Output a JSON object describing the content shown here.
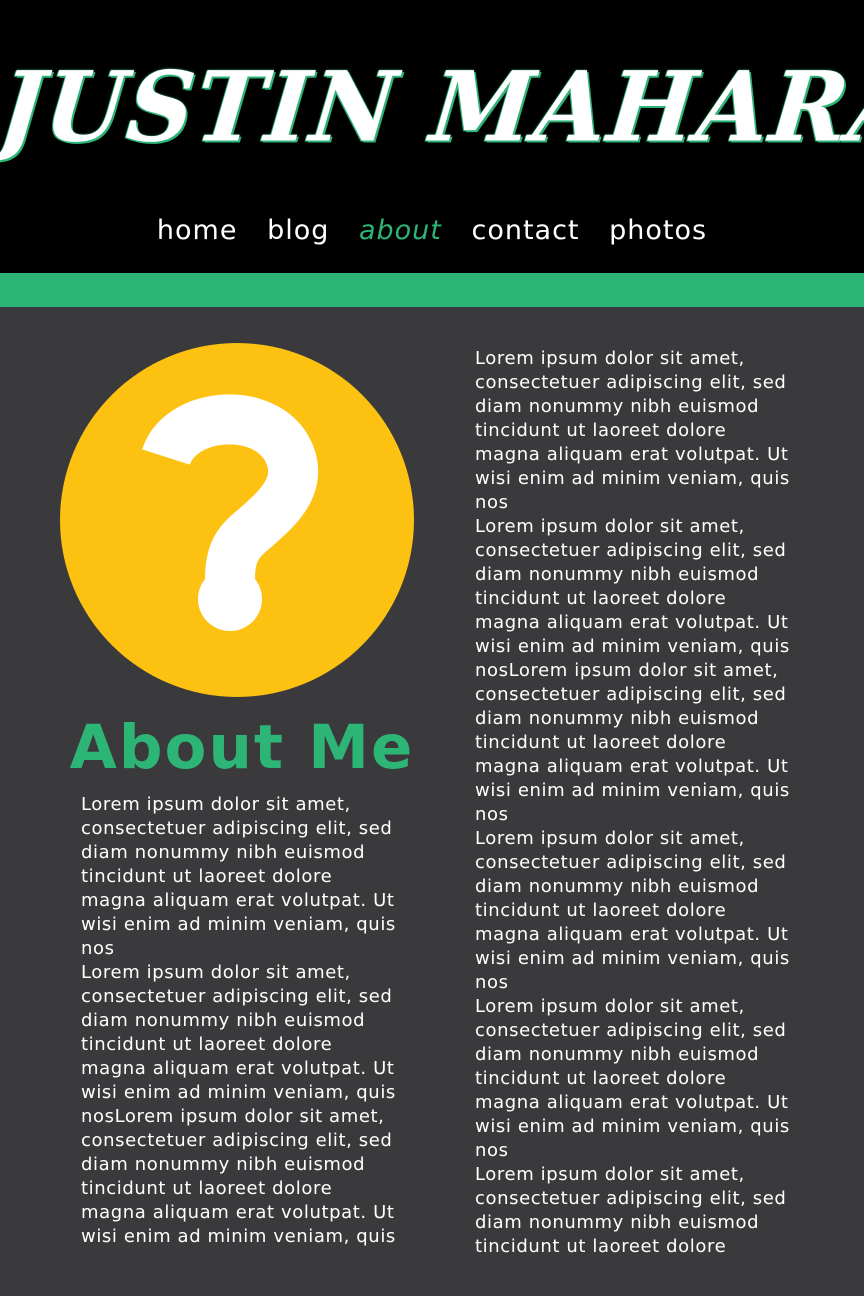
{
  "header": {
    "logo_text": "JUSTIN MAHARAJ",
    "nav": [
      {
        "label": "home"
      },
      {
        "label": "blog"
      },
      {
        "label": "about",
        "active": true
      },
      {
        "label": "contact"
      },
      {
        "label": "photos"
      }
    ]
  },
  "colors": {
    "background": "#3a3a3c",
    "header": "#000000",
    "accent": "#2db576",
    "avatar": "#fcc111",
    "text": "#ffffff"
  },
  "avatar": {
    "icon": "question-mark-icon",
    "glyph": "?"
  },
  "main": {
    "heading": "About Me",
    "left_lines": [
      "Lorem ipsum dolor sit amet,",
      "consectetuer adipiscing elit, sed",
      "diam nonummy nibh euismod",
      "tincidunt ut laoreet dolore",
      "magna aliquam erat volutpat. Ut",
      "wisi enim ad minim veniam, quis",
      "nos",
      "Lorem ipsum dolor sit amet,",
      "consectetuer adipiscing elit, sed",
      "diam nonummy nibh euismod",
      "tincidunt ut laoreet dolore",
      "magna aliquam erat volutpat. Ut",
      "wisi enim ad minim veniam, quis",
      "nosLorem ipsum dolor sit amet,",
      "consectetuer adipiscing elit, sed",
      "diam nonummy nibh euismod",
      "tincidunt ut laoreet dolore",
      "magna aliquam erat volutpat. Ut",
      "wisi enim ad minim veniam, quis"
    ],
    "right_lines": [
      "Lorem ipsum dolor sit amet,",
      "consectetuer adipiscing elit, sed",
      "diam nonummy nibh euismod",
      "tincidunt ut laoreet dolore",
      "magna aliquam erat volutpat. Ut",
      "wisi enim ad minim veniam, quis",
      "nos",
      "Lorem ipsum dolor sit amet,",
      "consectetuer adipiscing elit, sed",
      "diam nonummy nibh euismod",
      "tincidunt ut laoreet dolore",
      "magna aliquam erat volutpat. Ut",
      "wisi enim ad minim veniam, quis",
      "nosLorem ipsum dolor sit amet,",
      "consectetuer adipiscing elit, sed",
      "diam nonummy nibh euismod",
      "tincidunt ut laoreet dolore",
      "magna aliquam erat volutpat. Ut",
      "wisi enim ad minim veniam, quis",
      "nos",
      "Lorem ipsum dolor sit amet,",
      "consectetuer adipiscing elit, sed",
      "diam nonummy nibh euismod",
      "tincidunt ut laoreet dolore",
      "magna aliquam erat volutpat. Ut",
      "wisi enim ad minim veniam, quis",
      "nos",
      "Lorem ipsum dolor sit amet,",
      "consectetuer adipiscing elit, sed",
      "diam nonummy nibh euismod",
      "tincidunt ut laoreet dolore",
      "magna aliquam erat volutpat. Ut",
      "wisi enim ad minim veniam, quis",
      "nos",
      "Lorem ipsum dolor sit amet,",
      "consectetuer adipiscing elit, sed",
      "diam nonummy nibh euismod",
      "tincidunt ut laoreet dolore"
    ]
  }
}
